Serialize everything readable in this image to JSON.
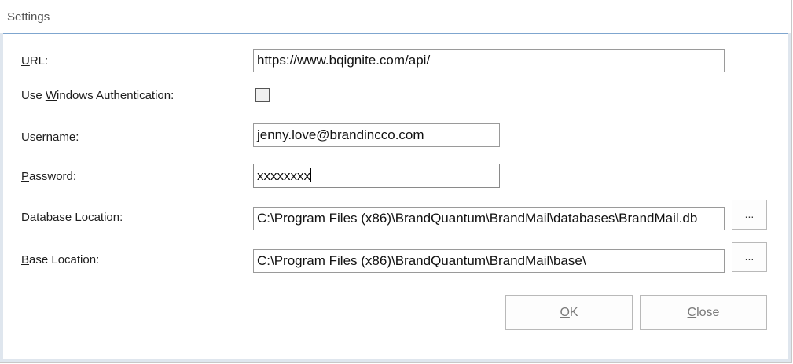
{
  "window": {
    "title": "Settings"
  },
  "form": {
    "url": {
      "label_mn": "U",
      "label_rest": "RL:",
      "value": "https://www.bqignite.com/api/"
    },
    "windows_auth": {
      "label_pre": "Use ",
      "label_mn": "W",
      "label_rest": "indows Authentication:",
      "checked": false
    },
    "username": {
      "label_pre": "U",
      "label_mn": "s",
      "label_rest": "ername:",
      "value": "jenny.love@brandincco.com"
    },
    "password": {
      "label_mn": "P",
      "label_rest": "assword:",
      "value": "xxxxxxxx"
    },
    "database_location": {
      "label_mn": "D",
      "label_rest": "atabase Location:",
      "value": "C:\\Program Files (x86)\\BrandQuantum\\BrandMail\\databases\\BrandMail.db",
      "browse_label": "..."
    },
    "base_location": {
      "label_mn": "B",
      "label_rest": "ase Location:",
      "value": "C:\\Program Files (x86)\\BrandQuantum\\BrandMail\\base\\",
      "browse_label": "..."
    }
  },
  "buttons": {
    "ok": {
      "mn": "O",
      "rest": "K"
    },
    "close": {
      "mn": "C",
      "rest": "lose"
    }
  }
}
